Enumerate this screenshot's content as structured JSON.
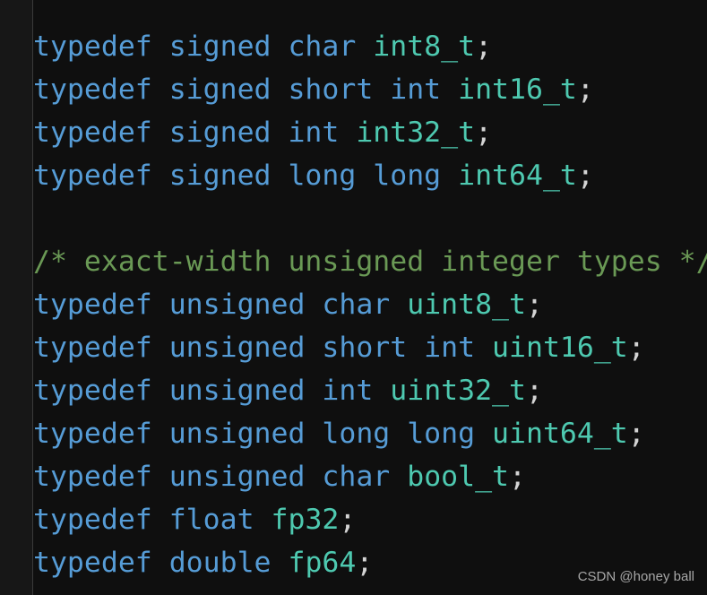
{
  "colors": {
    "keyword": "#569cd6",
    "type": "#4ec9b0",
    "comment": "#6a9955",
    "punct": "#d4d4d4"
  },
  "lines": [
    [
      [
        "kw",
        "typedef signed char "
      ],
      [
        "ty",
        "int8_t"
      ],
      [
        "pn",
        ";"
      ]
    ],
    [
      [
        "kw",
        "typedef signed short int "
      ],
      [
        "ty",
        "int16_t"
      ],
      [
        "pn",
        ";"
      ]
    ],
    [
      [
        "kw",
        "typedef signed int "
      ],
      [
        "ty",
        "int32_t"
      ],
      [
        "pn",
        ";"
      ]
    ],
    [
      [
        "kw",
        "typedef signed long long "
      ],
      [
        "ty",
        "int64_t"
      ],
      [
        "pn",
        ";"
      ]
    ],
    [],
    [
      [
        "cm",
        "/* exact-width unsigned integer types */"
      ]
    ],
    [
      [
        "kw",
        "typedef unsigned char "
      ],
      [
        "ty",
        "uint8_t"
      ],
      [
        "pn",
        ";"
      ]
    ],
    [
      [
        "kw",
        "typedef unsigned short int "
      ],
      [
        "ty",
        "uint16_t"
      ],
      [
        "pn",
        ";"
      ]
    ],
    [
      [
        "kw",
        "typedef unsigned int "
      ],
      [
        "ty",
        "uint32_t"
      ],
      [
        "pn",
        ";"
      ]
    ],
    [
      [
        "kw",
        "typedef unsigned long long "
      ],
      [
        "ty",
        "uint64_t"
      ],
      [
        "pn",
        ";"
      ]
    ],
    [
      [
        "kw",
        "typedef unsigned char "
      ],
      [
        "ty",
        "bool_t"
      ],
      [
        "pn",
        ";"
      ]
    ],
    [
      [
        "kw",
        "typedef float "
      ],
      [
        "ty",
        "fp32"
      ],
      [
        "pn",
        ";"
      ]
    ],
    [
      [
        "kw",
        "typedef double "
      ],
      [
        "ty",
        "fp64"
      ],
      [
        "pn",
        ";"
      ]
    ]
  ],
  "watermark": "CSDN @honey ball"
}
